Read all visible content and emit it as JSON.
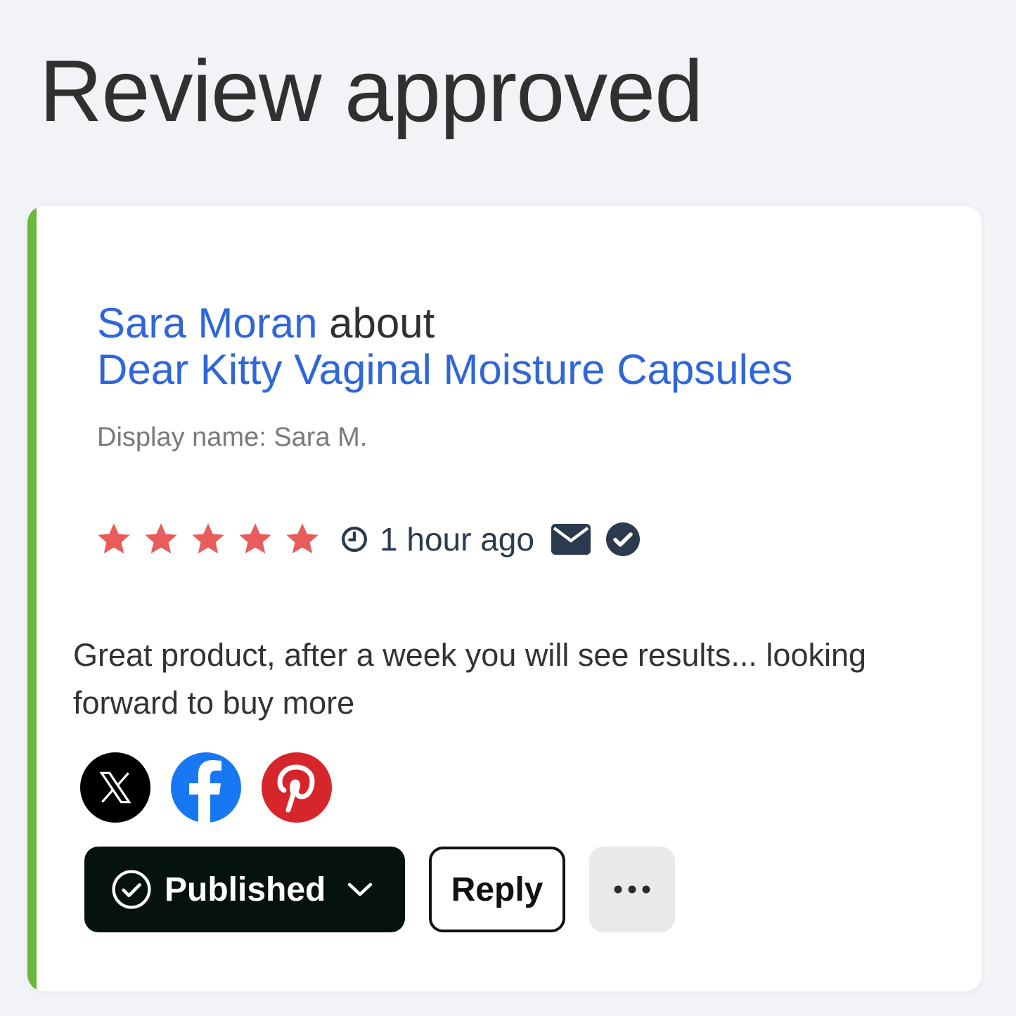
{
  "page": {
    "title": "Review approved",
    "accent_color": "#6bb93a"
  },
  "review": {
    "reviewer_name": "Sara Moran",
    "connector": "about",
    "product_name": "Dear Kitty Vaginal Moisture Capsules",
    "display_name": "Display name: Sara M.",
    "rating": 5,
    "rating_max": 5,
    "star_color": "#e85c5c",
    "time_ago": "1 hour ago",
    "icons": [
      "clock-icon",
      "mail-icon",
      "verified-icon"
    ],
    "body": "Great product, after a week you will see results... looking forward to buy more"
  },
  "social": [
    {
      "name": "x",
      "icon": "x-logo-icon",
      "color": "#000000"
    },
    {
      "name": "facebook",
      "icon": "facebook-logo-icon",
      "color": "#1877f2"
    },
    {
      "name": "pinterest",
      "icon": "pinterest-logo-icon",
      "color": "#d7252c"
    }
  ],
  "actions": {
    "status_label": "Published",
    "reply_label": "Reply",
    "more_icon": "ellipsis-icon"
  }
}
